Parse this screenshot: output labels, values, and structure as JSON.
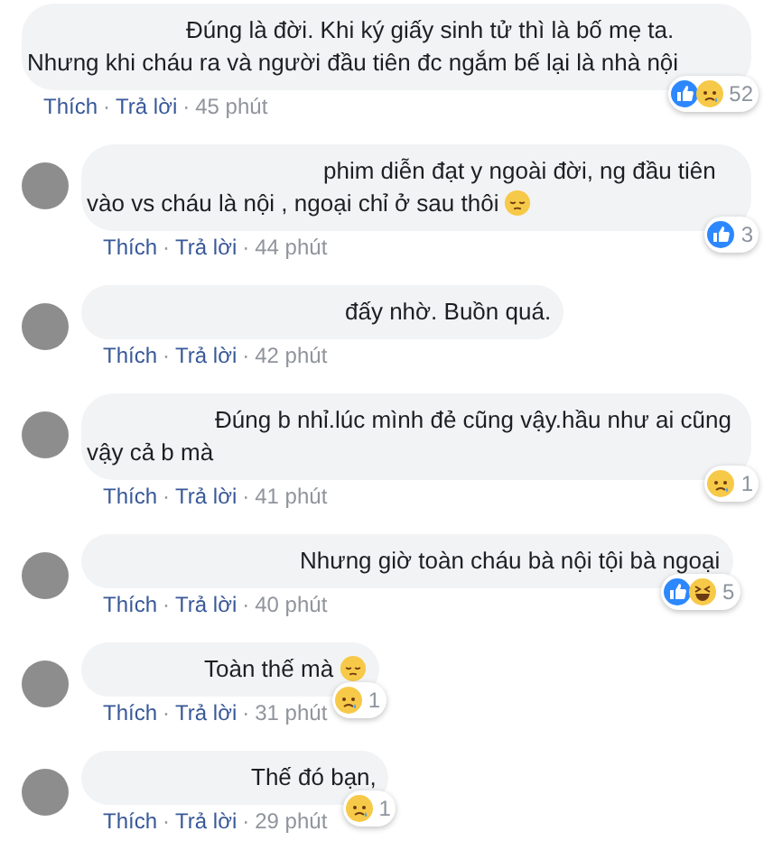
{
  "comments": [
    {
      "avatar": false,
      "text": "Đúng là đời. Khi ký giấy sinh tử thì là bố mẹ ta. Nhưng khi cháu ra và người đầu tiên đc ngắm bế lại là nhà nội",
      "emoji": false,
      "reactions": [
        {
          "kind": "like"
        },
        {
          "kind": "sad"
        }
      ],
      "count": "52",
      "like": "Thích",
      "sep1": "·",
      "reply": "Trả lời",
      "sep2": "·",
      "time": "45 phút"
    },
    {
      "avatar": true,
      "text": "phim diễn đạt y ngoài đời, ng đầu tiên vào vs cháu là nội , ngoại chỉ ở sau thôi",
      "emoji": true,
      "reactions": [
        {
          "kind": "like"
        }
      ],
      "count": "3",
      "like": "Thích",
      "sep1": "·",
      "reply": "Trả lời",
      "sep2": "·",
      "time": "44 phút"
    },
    {
      "avatar": true,
      "text": "đấy nhờ. Buồn quá.",
      "emoji": false,
      "like": "Thích",
      "sep1": "·",
      "reply": "Trả lời",
      "sep2": "·",
      "time": "42 phút"
    },
    {
      "avatar": true,
      "text": "Đúng b nhỉ.lúc mình đẻ cũng vậy.hầu như ai cũng vậy cả b mà",
      "emoji": false,
      "reactions": [
        {
          "kind": "sad"
        }
      ],
      "count": "1",
      "like": "Thích",
      "sep1": "·",
      "reply": "Trả lời",
      "sep2": "·",
      "time": "41 phút"
    },
    {
      "avatar": true,
      "text": "Nhưng giờ toàn cháu bà nội tội bà ngoại",
      "emoji": false,
      "reactions": [
        {
          "kind": "like"
        },
        {
          "kind": "haha"
        }
      ],
      "count": "5",
      "like": "Thích",
      "sep1": "·",
      "reply": "Trả lời",
      "sep2": "·",
      "time": "40 phút"
    },
    {
      "avatar": true,
      "text": "Toàn thế mà",
      "emoji": true,
      "reactions": [
        {
          "kind": "sad"
        }
      ],
      "count": "1",
      "like": "Thích",
      "sep1": "·",
      "reply": "Trả lời",
      "sep2": "·",
      "time": "31 phút"
    },
    {
      "avatar": true,
      "text": "Thế đó bạn,",
      "emoji": false,
      "reactions": [
        {
          "kind": "sad"
        }
      ],
      "count": "1",
      "like": "Thích",
      "sep1": "·",
      "reply": "Trả lời",
      "sep2": "·",
      "time": "29 phút"
    }
  ]
}
